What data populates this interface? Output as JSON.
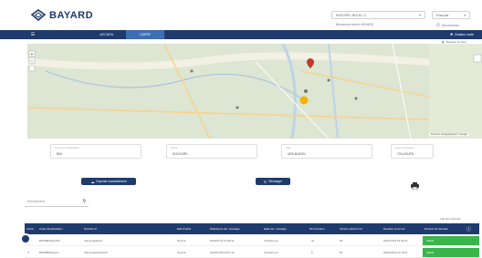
{
  "app": {
    "logo_text": "BAYARD"
  },
  "header": {
    "account_select": "KNS REFL BRLKC C",
    "account_subtext": "Bienvenue dans le BAYARD",
    "lang_select": "Français",
    "logout_label": "Déconnexion"
  },
  "nav": {
    "items": [
      "ACCUEIL",
      "CARTE"
    ],
    "active_index": 1,
    "right_label": "Gestion carte",
    "second_right_label": "Masquer la carte"
  },
  "map": {
    "scale_text": "Données cartographiques © Google"
  },
  "fields": [
    {
      "label": "Nom de l'implantation",
      "value": "BKK"
    },
    {
      "label": "Statut",
      "value": "ENCOURS"
    },
    {
      "label": "Ville",
      "value": "ARS-BUEON"
    },
    {
      "label": "Date de dernière",
      "value": "TOUJOURS"
    }
  ],
  "actions": {
    "export_label": "Exporter manuellement",
    "refresh_label": "Recharger"
  },
  "search": {
    "placeholder": "Rechercher"
  },
  "table": {
    "right_link": "Voir les colonnes",
    "columns": [
      "Action",
      "Code d'implantation",
      "Nombre Id",
      "Etat Produit",
      "Date/heure der. message",
      "Etats der. message",
      "Nb Courriers",
      "Version schema V1",
      "Dernière envoi sur",
      "Numéro de Vendeur"
    ],
    "rows": [
      {
        "code": "BRVMBANjgnf1R",
        "name": "Vianneudgbhup",
        "etat": "Normal",
        "datetime": "2022/07/11 10:09:32",
        "msg": "Transfert ok",
        "nb": "41",
        "version": "R1",
        "last": "2022/10/11 15:18:21",
        "status": "Validé"
      },
      {
        "code": "BRVMBAN4ypm",
        "name": "Vianneudyp3a7xb5t",
        "etat": "Normal",
        "datetime": "2022/07/09 10:07:12",
        "msg": "Transfert ok",
        "nb": "6",
        "version": "R1",
        "last": "2022/10/10 14:18:47",
        "status": "Validé"
      }
    ]
  },
  "colors": {
    "navy": "#1f3b6d",
    "blue": "#3d6eb3",
    "green": "#39b54a",
    "map_bg": "#dfe6d8"
  }
}
